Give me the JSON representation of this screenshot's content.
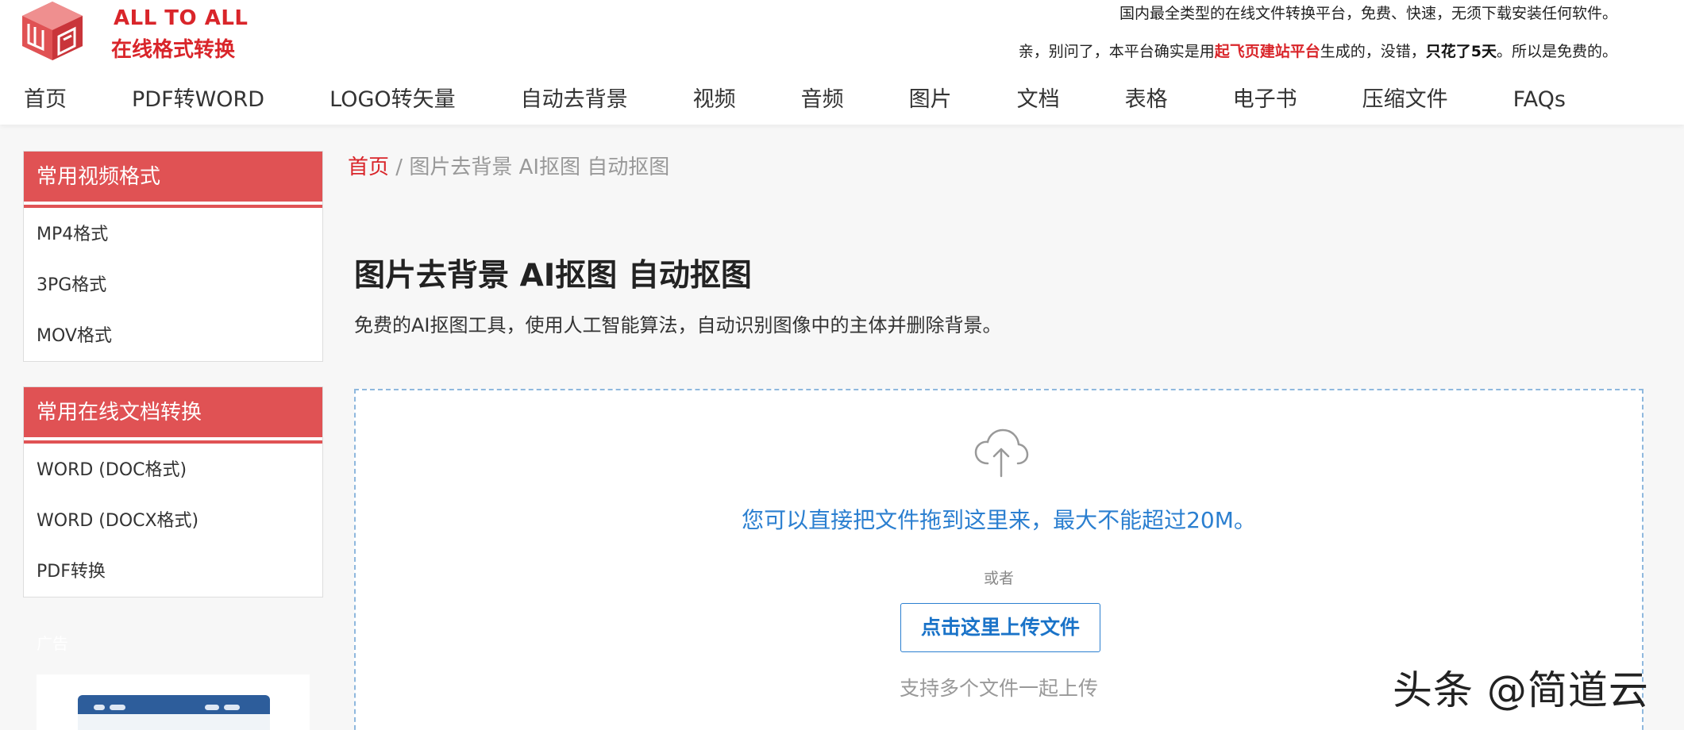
{
  "header": {
    "logo_en": "ALL TO ALL",
    "logo_cn": "在线格式转换",
    "tagline_1": "国内最全类型的在线文件转换平台，免费、快速，无须下载安装任何软件。",
    "tagline_2_prefix": "亲，别问了，本平台确实是用",
    "tagline_2_highlight": "起飞页建站平台",
    "tagline_2_middle": "生成的，没错，",
    "tagline_2_bold": "只花了5天",
    "tagline_2_suffix": "。所以是免费的。"
  },
  "nav": {
    "items": [
      "首页",
      "PDF转WORD",
      "LOGO转矢量",
      "自动去背景",
      "视频",
      "音频",
      "图片",
      "文档",
      "表格",
      "电子书",
      "压缩文件",
      "FAQs"
    ]
  },
  "sidebar": {
    "box1": {
      "title": "常用视频格式",
      "items": [
        "MP4格式",
        "3PG格式",
        "MOV格式"
      ]
    },
    "box2": {
      "title": "常用在线文档转换",
      "items": [
        "WORD (DOC格式)",
        "WORD (DOCX格式)",
        "PDF转换"
      ]
    },
    "ad_label": "广告"
  },
  "breadcrumb": {
    "home": "首页",
    "separator": " / ",
    "current": "图片去背景 AI抠图 自动抠图"
  },
  "main": {
    "title": "图片去背景 AI抠图 自动抠图",
    "subtitle": "免费的AI抠图工具，使用人工智能算法，自动识别图像中的主体并删除背景。",
    "upload": {
      "icon": "cloud-upload-icon",
      "drop_text": "您可以直接把文件拖到这里来，最大不能超过20M。",
      "or_text": "或者",
      "button_label": "点击这里上传文件",
      "multi_text": "支持多个文件一起上传"
    }
  },
  "watermark": "头条 @简道云",
  "colors": {
    "brand_red": "#d9252a",
    "sidebar_red": "#e05254",
    "link_blue": "#2b7fd0"
  }
}
